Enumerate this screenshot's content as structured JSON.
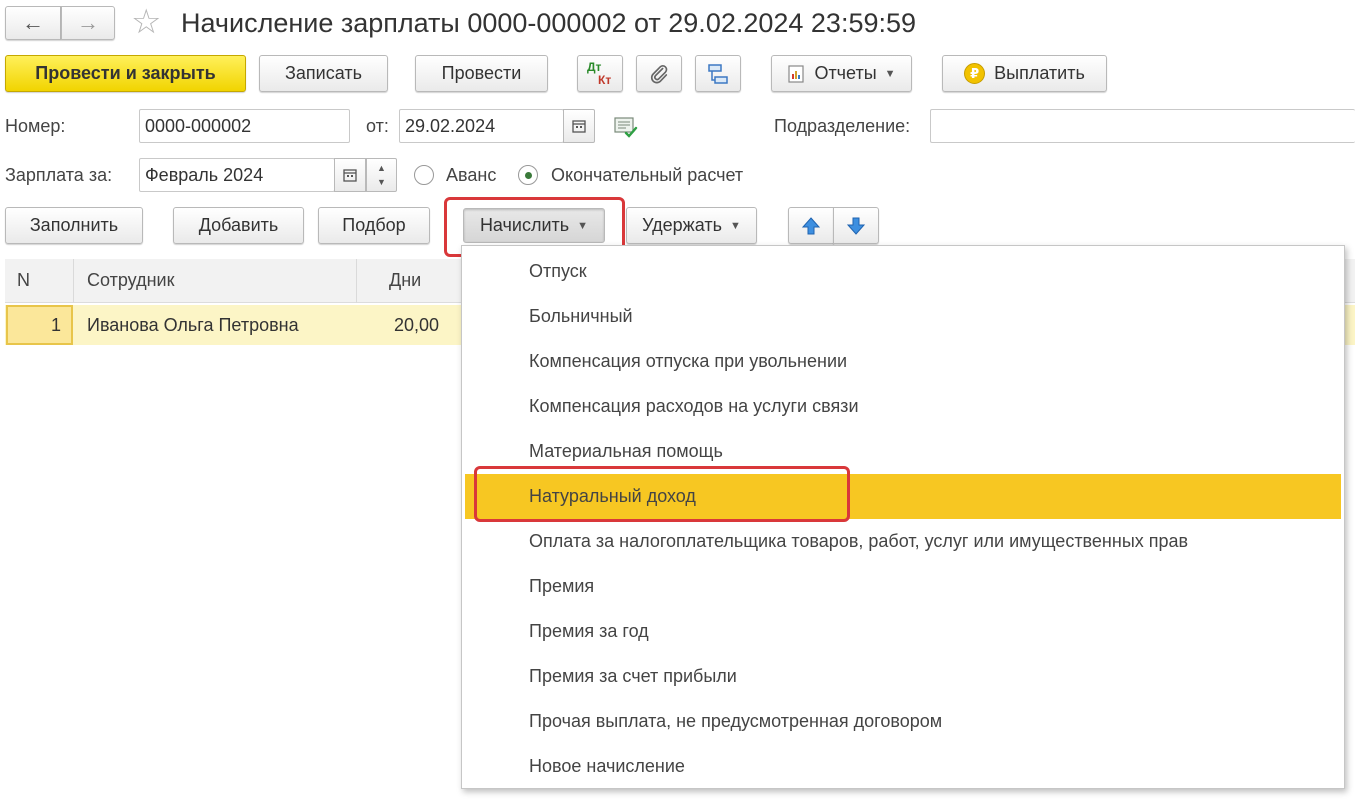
{
  "title": "Начисление зарплаты 0000-000002 от 29.02.2024 23:59:59",
  "nav": {
    "back": "←",
    "forward": "→",
    "star": "☆"
  },
  "toolbar": {
    "post_close": "Провести и закрыть",
    "save": "Записать",
    "post": "Провести",
    "dt_kt_top": "Дт",
    "dt_kt_bottom": "Кт",
    "reports": "Отчеты",
    "pay": "Выплатить"
  },
  "form": {
    "number_label": "Номер:",
    "number_value": "0000-000002",
    "date_label": "от:",
    "date_value": "29.02.2024",
    "division_label": "Подразделение:",
    "division_value": "",
    "salary_for_label": "Зарплата за:",
    "salary_for_value": "Февраль 2024",
    "advance_label": "Аванс",
    "final_label": "Окончательный расчет"
  },
  "actions": {
    "fill": "Заполнить",
    "add": "Добавить",
    "select": "Подбор",
    "accrue": "Начислить",
    "withhold": "Удержать"
  },
  "table": {
    "headers": [
      "N",
      "Сотрудник",
      "Дни"
    ],
    "rows": [
      {
        "n": "1",
        "employee": "Иванова Ольга Петровна",
        "days": "20,00"
      }
    ]
  },
  "menu": {
    "items": [
      "Отпуск",
      "Больничный",
      "Компенсация отпуска при увольнении",
      "Компенсация расходов на услуги связи",
      "Материальная помощь",
      "Натуральный доход",
      "Оплата за налогоплательщика товаров, работ, услуг или имущественных прав",
      "Премия",
      "Премия за год",
      "Премия за счет прибыли",
      "Прочая выплата, не предусмотренная договором",
      "Новое начисление"
    ],
    "active_index": 5
  },
  "colors": {
    "primary": "#f1d400",
    "highlight": "#f7c722",
    "selected_row": "#fcf5c6",
    "annotation": "#d9383a"
  }
}
